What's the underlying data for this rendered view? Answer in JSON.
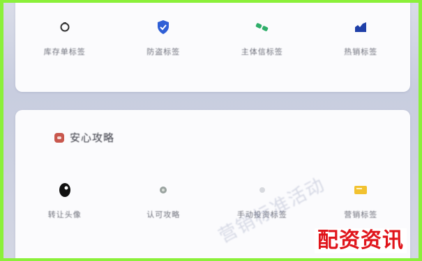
{
  "top_tools": [
    {
      "label": "库存单标签",
      "icon": "clock-icon"
    },
    {
      "label": "防盗标签",
      "icon": "shield-icon"
    },
    {
      "label": "主体信标签",
      "icon": "signal-icon"
    },
    {
      "label": "热销标签",
      "icon": "chart-icon"
    }
  ],
  "section": {
    "title": "安心攻略"
  },
  "bottom_tools": [
    {
      "label": "转让头像",
      "icon": "avatar-icon"
    },
    {
      "label": "认可攻略",
      "icon": "shield-small-icon"
    },
    {
      "label": "手动投资标签",
      "icon": "dot-icon"
    },
    {
      "label": "营销标签",
      "icon": "card-icon"
    }
  ],
  "watermark": "营销标准活动",
  "brand": "配资资讯",
  "colors": {
    "frame": "#8bf03a",
    "card": "#fbfbfd",
    "brand_red": "#e0141a",
    "shield_blue": "#2f5fd6",
    "signal_green": "#2fae6a",
    "section_icon": "#c8574d"
  }
}
